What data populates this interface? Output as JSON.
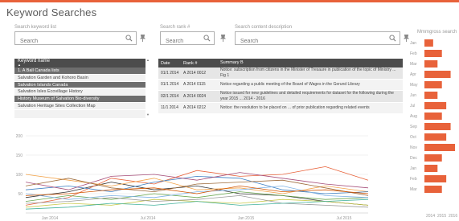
{
  "page": {
    "title": "Keyword Searches",
    "accent": "#e8623a"
  },
  "filters": {
    "keyword": {
      "label": "Search keyword list",
      "placeholder": "Search"
    },
    "rank": {
      "label": "Search rank #",
      "placeholder": "Search"
    },
    "content": {
      "label": "Search content description",
      "placeholder": "Search"
    }
  },
  "keyword_list": {
    "header": "Keyword name",
    "header_sub": "▲",
    "items": [
      {
        "label": "1. A Ball Canada lists",
        "selected": true
      },
      {
        "label": "Salvation Garden and Kohoro Basin",
        "selected": false
      },
      {
        "label": "Salvation Islands Canada",
        "selected": true
      },
      {
        "label": "Salvation Isles Ecovillage History",
        "selected": false
      },
      {
        "label": "History Museum of Salvation Bio-diversity",
        "selected": true
      },
      {
        "label": "Salvation Heritage Sites Collection Map",
        "selected": false
      }
    ]
  },
  "detail_table": {
    "columns": [
      "Date",
      "Rank #",
      "Summary B"
    ],
    "rows": [
      {
        "date": "01/1 2014",
        "rank": "A 2014 0012",
        "summary": "Notice: subscription from citizens in the Minister of Tresaure in publication of the topic of Ministry ... Fig 1"
      },
      {
        "date": "01/1 2014",
        "rank": "A 2014 0115",
        "summary": "Notice regarding a public meeting of the Board of Wages in the Gerund Library"
      },
      {
        "date": "02/1 2014",
        "rank": "A 2014 0024",
        "summary": "Notice issued for new guidelines and detailed requirements for dataset for the following during the year 2015 ... 2014 - 2016"
      },
      {
        "date": "11/1 2014",
        "rank": "A 2014 0212",
        "summary": "Notice: the resolution to be placed on ... of prior publication regarding related events"
      }
    ]
  },
  "bar_panel": {
    "label": "Mmmgross search",
    "bar_color": "#e8623a",
    "categories": [
      "Jan",
      "Feb",
      "Mar",
      "Apr",
      "May",
      "Jun",
      "Jul",
      "Aug",
      "Sep",
      "Oct",
      "Nov",
      "Dec",
      "Jan",
      "Feb",
      "Mar"
    ],
    "values": [
      2,
      4,
      3,
      6,
      4,
      3,
      5,
      4,
      6,
      5,
      7,
      4,
      3,
      5,
      4
    ],
    "axis_ticks": [
      "2014",
      "2015",
      "2016"
    ]
  },
  "chart_data": {
    "type": "line",
    "title": "",
    "xlabel": "",
    "ylabel": "",
    "ylim": [
      0,
      200
    ],
    "y_ticks": [
      "200",
      "150",
      "100",
      "50"
    ],
    "x_ticks": [
      "Jan 2014",
      "Jul 2014",
      "Jan 2015",
      "Jul 2015"
    ],
    "grid": true,
    "series": [
      {
        "color": "#333333",
        "values": [
          40,
          55,
          80,
          60,
          70,
          50,
          45,
          30,
          20
        ]
      },
      {
        "color": "#e8623a",
        "values": [
          20,
          40,
          90,
          75,
          110,
          95,
          100,
          120,
          85
        ]
      },
      {
        "color": "#f2a34a",
        "values": [
          100,
          85,
          70,
          90,
          60,
          65,
          50,
          70,
          55
        ]
      },
      {
        "color": "#3b7fc4",
        "values": [
          60,
          70,
          55,
          80,
          95,
          90,
          60,
          50,
          55
        ]
      },
      {
        "color": "#6aa84f",
        "values": [
          30,
          45,
          35,
          50,
          40,
          55,
          45,
          35,
          40
        ]
      },
      {
        "color": "#a64d79",
        "values": [
          80,
          60,
          95,
          100,
          85,
          105,
          90,
          75,
          65
        ]
      },
      {
        "color": "#c9c94a",
        "values": [
          15,
          25,
          20,
          35,
          30,
          25,
          35,
          30,
          20
        ]
      },
      {
        "color": "#7fb2e5",
        "values": [
          50,
          35,
          45,
          40,
          55,
          60,
          70,
          45,
          40
        ]
      },
      {
        "color": "#9e6b3a",
        "values": [
          70,
          90,
          65,
          55,
          75,
          80,
          85,
          65,
          45
        ]
      },
      {
        "color": "#999999",
        "values": [
          25,
          30,
          40,
          30,
          35,
          45,
          25,
          20,
          15
        ]
      },
      {
        "color": "#45b39d",
        "values": [
          10,
          15,
          25,
          20,
          30,
          20,
          25,
          30,
          35
        ]
      },
      {
        "color": "#d35400",
        "values": [
          45,
          50,
          60,
          65,
          50,
          70,
          55,
          60,
          50
        ]
      }
    ]
  }
}
